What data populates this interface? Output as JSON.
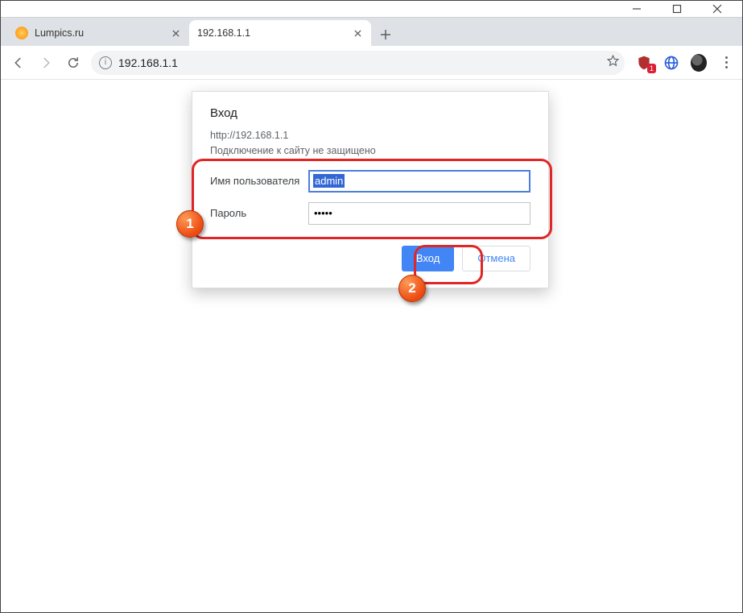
{
  "window": {
    "controls": {
      "min": "minimize",
      "max": "maximize",
      "close": "close"
    }
  },
  "tabs": [
    {
      "title": "Lumpics.ru",
      "active": false
    },
    {
      "title": "192.168.1.1",
      "active": true
    }
  ],
  "addressbar": {
    "url": "192.168.1.1"
  },
  "ext": {
    "badge": "1"
  },
  "dialog": {
    "title": "Вход",
    "origin": "http://192.168.1.1",
    "warning": "Подключение к сайту не защищено",
    "username_label": "Имя пользователя",
    "username_value": "admin",
    "password_label": "Пароль",
    "password_value": "•••••",
    "submit": "Вход",
    "cancel": "Отмена"
  },
  "annotations": {
    "step1": "1",
    "step2": "2"
  }
}
